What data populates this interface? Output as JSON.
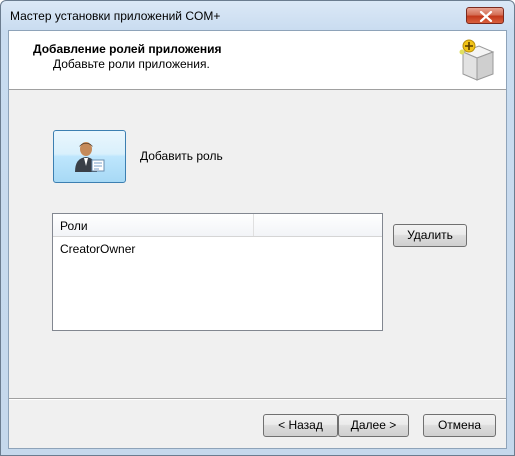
{
  "window": {
    "title": "Мастер установки приложений COM+"
  },
  "header": {
    "title": "Добавление ролей приложения",
    "subtitle": "Добавьте роли приложения."
  },
  "roles": {
    "add_label": "Добавить роль",
    "columns": [
      "Роли",
      ""
    ],
    "rows": [
      "CreatorOwner"
    ],
    "delete_label": "Удалить"
  },
  "footer": {
    "back_label": "< Назад",
    "next_label": "Далее >",
    "cancel_label": "Отмена"
  },
  "colors": {
    "client_bg": "#f0f0f0",
    "close_red": "#c3391b",
    "selection_blue": "#3c7fb1"
  },
  "icons": {
    "close": "close-icon",
    "header": "package-add-icon",
    "add_role": "user-role-icon"
  }
}
